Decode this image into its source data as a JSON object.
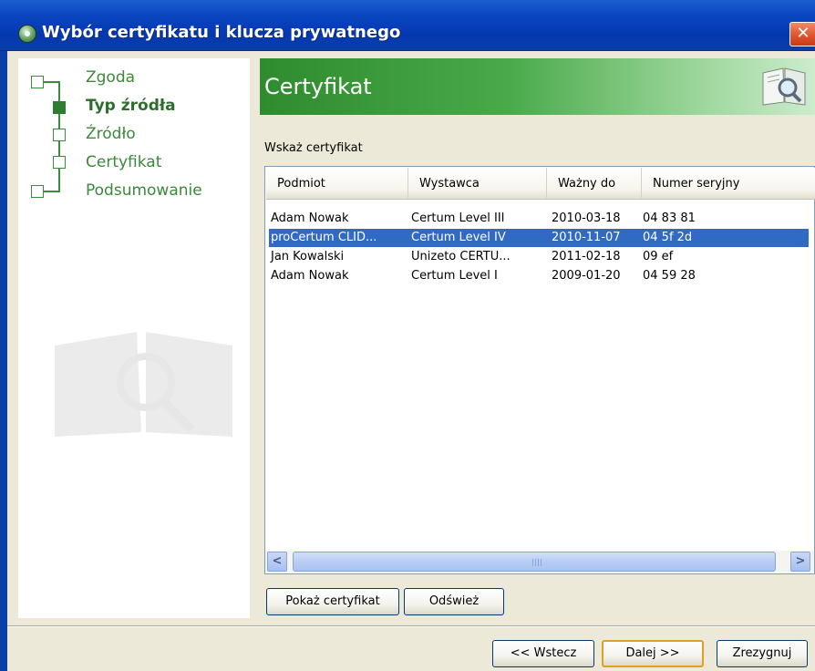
{
  "window": {
    "title": "Wybór certyfikatu i klucza prywatnego",
    "close_glyph": "✕"
  },
  "wizard_steps": [
    {
      "label": "Zgoda",
      "active": false
    },
    {
      "label": "Typ źródła",
      "active": true
    },
    {
      "label": "Źródło",
      "active": false
    },
    {
      "label": "Certyfikat",
      "active": false
    },
    {
      "label": "Podsumowanie",
      "active": false
    }
  ],
  "header": {
    "title": "Certyfikat",
    "icon": "book-magnifier-icon"
  },
  "main": {
    "prompt": "Wskaż certyfikat",
    "columns": [
      "Podmiot",
      "Wystawca",
      "Ważny do",
      "Numer seryjny"
    ],
    "rows": [
      {
        "subject": "Adam Nowak",
        "issuer": "Certum Level III",
        "valid_to": "2010-03-18",
        "serial": "04 83 81",
        "selected": false
      },
      {
        "subject": "proCertum CLID...",
        "issuer": "Certum Level IV",
        "valid_to": "2010-11-07",
        "serial": "04 5f 2d",
        "selected": true
      },
      {
        "subject": "Jan Kowalski",
        "issuer": "Unizeto CERTU...",
        "valid_to": "2011-02-18",
        "serial": "09 ef",
        "selected": false
      },
      {
        "subject": "Adam Nowak",
        "issuer": "Certum Level I",
        "valid_to": "2009-01-20",
        "serial": "04 59 28",
        "selected": false
      }
    ],
    "scroll_left": "<",
    "scroll_right": ">",
    "show_cert_label": "Pokaż certyfikat",
    "refresh_label": "Odśwież"
  },
  "footer": {
    "back_label": "<< Wstecz",
    "next_label": "Dalej >>",
    "cancel_label": "Zrezygnuj"
  },
  "colors": {
    "title_bar": "#0a46c2",
    "accent_green": "#3a8a3a",
    "selection": "#316ac5"
  }
}
